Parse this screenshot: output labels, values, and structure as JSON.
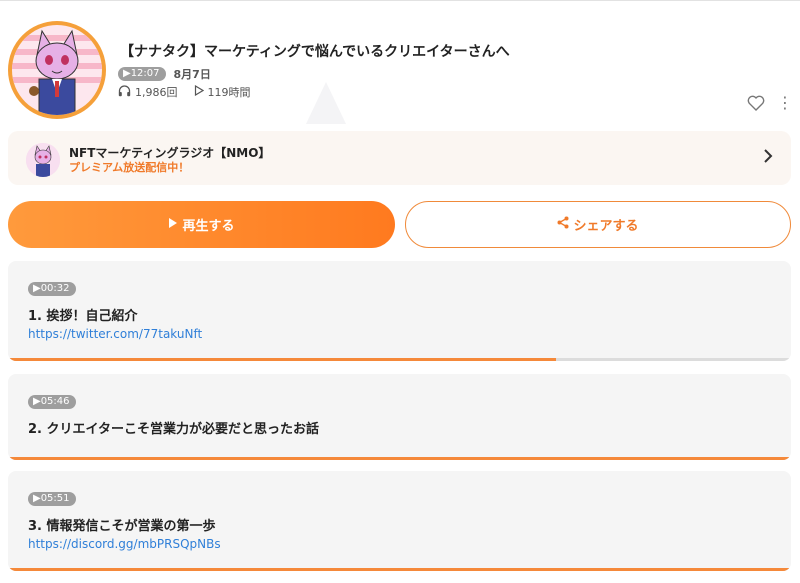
{
  "episode": {
    "title": "【ナナタク】マーケティングで悩んでいるクリエイターさんへ",
    "duration": "▶12:07",
    "date": "8月7日",
    "plays": "1,986回",
    "total_time": "119時間"
  },
  "channel": {
    "name": "NFTマーケティングラジオ【NMO】",
    "subtitle": "プレミアム放送配信中！"
  },
  "buttons": {
    "play_label": "再生する",
    "share_label": "シェアする"
  },
  "chapters": [
    {
      "time": "▶00:32",
      "title": "1. 挨拶！自己紹介",
      "link": "https://twitter.com/77takuNft",
      "progress": 0.7
    },
    {
      "time": "▶05:46",
      "title": "2. クリエイターこそ営業力が必要だと思ったお話",
      "link": "",
      "progress": 1.0
    },
    {
      "time": "▶05:51",
      "title": "3. 情報発信こそが営業の第一歩",
      "link": "https://discord.gg/mbPRSQpNBs",
      "progress": 1.0
    }
  ],
  "colors": {
    "accent": "#f5893a",
    "link": "#2f7fd8",
    "badge": "#9e9e9e"
  },
  "icons": [
    "headphones-icon",
    "play-count-icon",
    "heart-icon",
    "more-icon",
    "chevron-right-icon",
    "play-icon",
    "share-icon"
  ]
}
